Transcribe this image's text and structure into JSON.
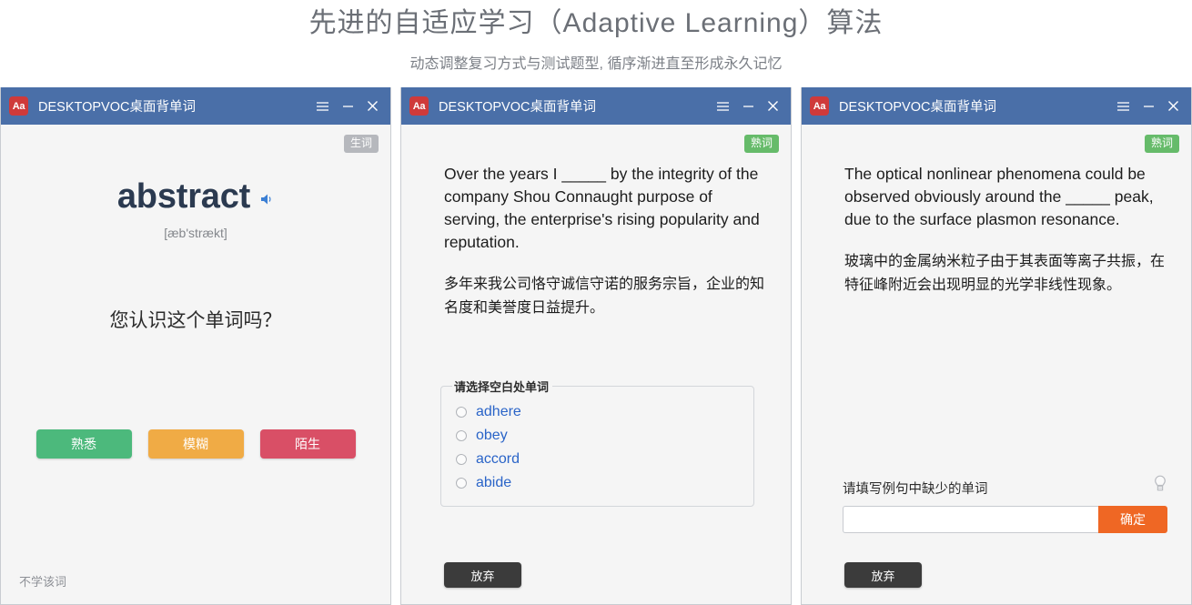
{
  "header": {
    "title": "先进的自适应学习（Adaptive Learning）算法",
    "subtitle": "动态调整复习方式与测试题型, 循序渐进直至形成永久记忆"
  },
  "window_common": {
    "logo_text": "Aa",
    "app_title": "DESKTOPVOC桌面背单词",
    "menu_icon": "hamburger-menu-icon",
    "minimize_icon": "minimize-icon",
    "close_icon": "close-icon"
  },
  "colors": {
    "titlebar": "#4a6fa8",
    "logo": "#cf3a3a",
    "badge_gray": "#b6b8bd",
    "badge_green": "#66bb6a",
    "familiar": "#4cb97c",
    "vague": "#f0ab45",
    "strange": "#d94f66",
    "submit": "#ef6724",
    "dark_button": "#3b3b3b",
    "option_text": "#2a64c8"
  },
  "window1": {
    "badge": "生词",
    "word": "abstract",
    "speaker_icon": "speaker-icon",
    "phonetic": "[æb'strækt]",
    "question": "您认识这个单词吗？",
    "buttons": {
      "familiar": "熟悉",
      "vague": "模糊",
      "strange": "陌生"
    },
    "skip_link": "不学该词"
  },
  "window2": {
    "badge": "熟词",
    "sentence_en": "Over the years I _____ by the integrity of the company Shou Connaught purpose of serving, the enterprise's rising popularity and reputation.",
    "sentence_cn": "多年来我公司恪守诚信守诺的服务宗旨，企业的知名度和美誉度日益提升。",
    "options_legend": "请选择空白处单词",
    "options": [
      "adhere",
      "obey",
      "accord",
      "abide"
    ],
    "give_up_button": "放弃"
  },
  "window3": {
    "badge": "熟词",
    "sentence_en": "The optical nonlinear phenomena could be observed obviously around the _____ peak, due to the surface plasmon resonance.",
    "sentence_cn": "玻璃中的金属纳米粒子由于其表面等离子共振，在特征峰附近会出现明显的光学非线性现象。",
    "answer_label": "请填写例句中缺少的单词",
    "hint_icon": "lightbulb-icon",
    "answer_value": "",
    "answer_placeholder": "",
    "submit_button": "确定",
    "give_up_button": "放弃"
  }
}
